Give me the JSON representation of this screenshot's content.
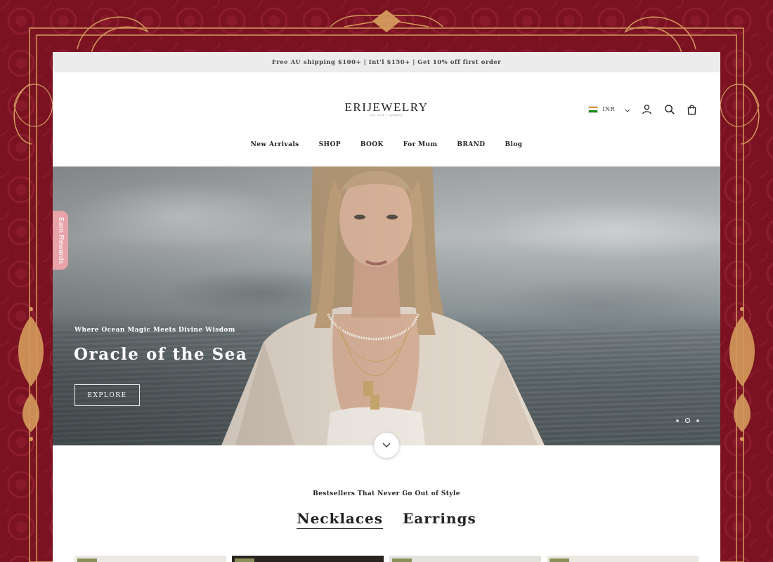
{
  "announcement": "Free AU shipping $100+ | Int'l $150+ | Get 10% off first order",
  "logo": {
    "name": "ERIJEWELRY",
    "sub": "est 2017 sydney"
  },
  "currency": {
    "code": "INR"
  },
  "nav": [
    "New Arrivals",
    "SHOP",
    "BOOK",
    "For Mum",
    "BRAND",
    "Blog"
  ],
  "hero": {
    "eyebrow": "Where Ocean Magic Meets Divine Wisdom",
    "title": "Oracle of the Sea",
    "cta": "EXPLORE",
    "slides": 3,
    "active_slide": 2
  },
  "rewards_tab": "Earn Rewards",
  "bestsellers": {
    "kicker": "Bestsellers That Never Go Out of Style",
    "tabs": [
      {
        "label": "Necklaces",
        "active": true
      },
      {
        "label": "Earrings",
        "active": false
      }
    ]
  },
  "colors": {
    "background": "#6f0f1e",
    "ornament": "#d49a5c",
    "rewards": "#e8a3a8"
  },
  "icons": [
    "account-icon",
    "search-icon",
    "cart-icon",
    "chevron-down-icon",
    "india-flag-icon"
  ]
}
